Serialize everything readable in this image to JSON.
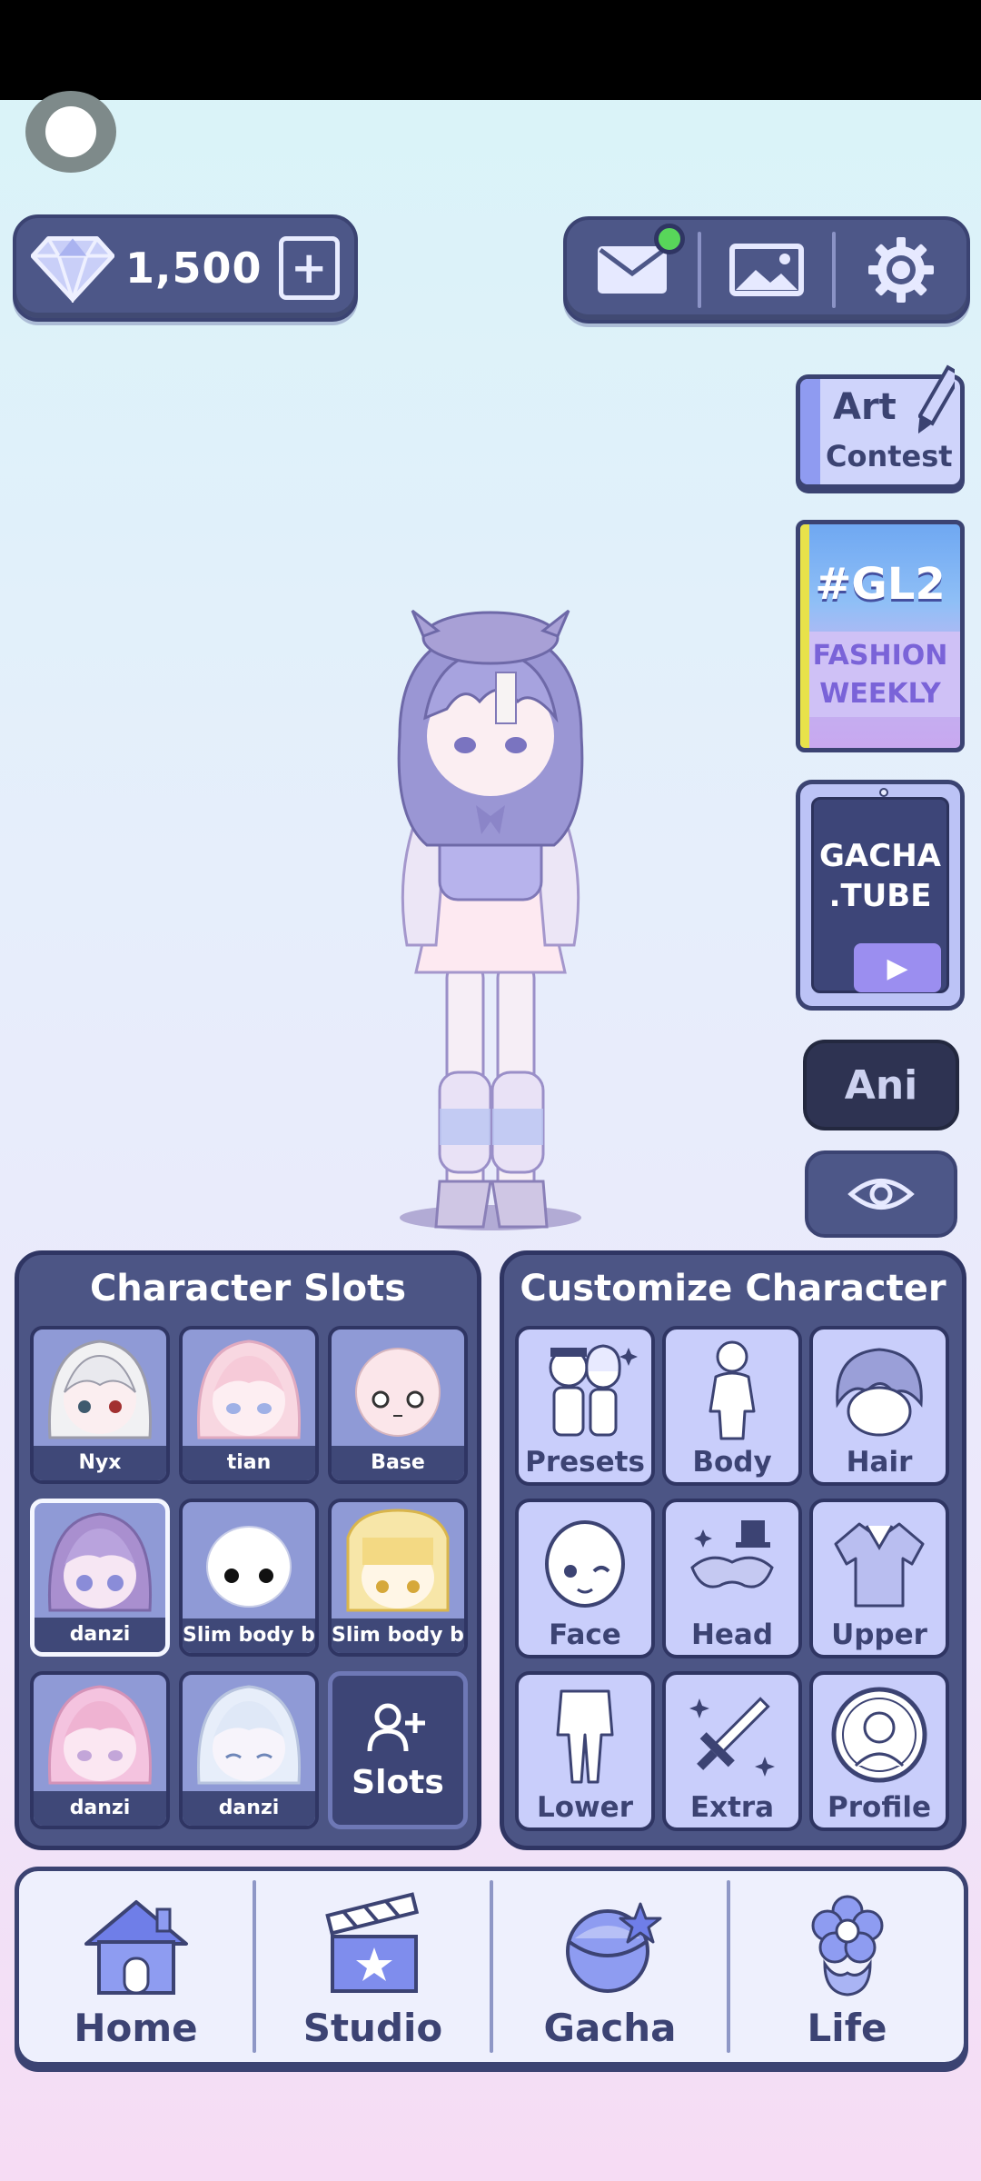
{
  "header": {
    "currency": {
      "value": "1,500",
      "icon": "diamond-icon",
      "add_icon": "add-gems-icon"
    },
    "actions": [
      {
        "name": "mail-icon",
        "has_notification": true
      },
      {
        "name": "gallery-icon"
      },
      {
        "name": "settings-icon"
      }
    ]
  },
  "side": {
    "art_contest": {
      "line1": "Art",
      "line2": "Contest"
    },
    "gl2": {
      "title": "#GL2",
      "line1": "FASHION",
      "line2": "WEEKLY"
    },
    "gacha_tube": {
      "line1": "GACHA",
      "line2": ".TUBE"
    },
    "ani_label": "Ani",
    "eye_icon": "eye-icon"
  },
  "slots_panel": {
    "title": "Character Slots",
    "slots": [
      {
        "label": "Nyx",
        "hair": "#f1f1f3",
        "skin": "#fbeef0"
      },
      {
        "label": "tian",
        "hair": "#f8d7e1",
        "skin": "#fdeef2"
      },
      {
        "label": "Base",
        "hair": "",
        "skin": "#fbe6ea"
      },
      {
        "label": "danzi",
        "hair": "#a98fcf",
        "skin": "#f6e6f3"
      },
      {
        "label": "Slim body bas",
        "hair": "",
        "skin": "#ffffff"
      },
      {
        "label": "Slim body bas",
        "hair": "#f7e6a8",
        "skin": "#fff6e6"
      },
      {
        "label": "danzi",
        "hair": "#f4c3df",
        "skin": "#fbe7f2"
      },
      {
        "label": "danzi",
        "hair": "#e7eefa",
        "skin": "#f7f4fb"
      }
    ],
    "add_label": "Slots"
  },
  "customize_panel": {
    "title": "Customize Character",
    "items": [
      "Presets",
      "Body",
      "Hair",
      "Face",
      "Head",
      "Upper",
      "Lower",
      "Extra",
      "Profile"
    ]
  },
  "bottom_nav": {
    "items": [
      {
        "label": "Home",
        "icon": "house-icon"
      },
      {
        "label": "Studio",
        "icon": "clapperboard-icon"
      },
      {
        "label": "Gacha",
        "icon": "gacha-capsule-icon"
      },
      {
        "label": "Life",
        "icon": "flower-icon"
      }
    ]
  },
  "colors": {
    "panel": "#4c5585",
    "panel_border": "#2f3563",
    "card": "#c9cefb",
    "notification": "#58d65a"
  }
}
